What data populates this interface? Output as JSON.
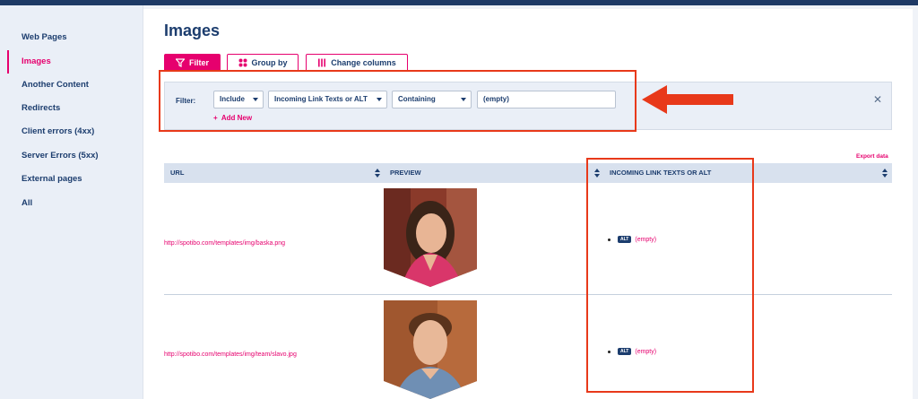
{
  "sidebar": {
    "items": [
      {
        "label": "Web Pages",
        "active": false
      },
      {
        "label": "Images",
        "active": true
      },
      {
        "label": "Another Content",
        "active": false
      },
      {
        "label": "Redirects",
        "active": false
      },
      {
        "label": "Client errors (4xx)",
        "active": false
      },
      {
        "label": "Server Errors (5xx)",
        "active": false
      },
      {
        "label": "External pages",
        "active": false
      },
      {
        "label": "All",
        "active": false
      }
    ]
  },
  "page": {
    "title": "Images"
  },
  "toolbar": {
    "filter_label": "Filter",
    "group_by_label": "Group by",
    "change_columns_label": "Change columns"
  },
  "filter": {
    "label": "Filter:",
    "mode": "Include",
    "field": "Incoming Link Texts or ALT",
    "operator": "Containing",
    "value": "(empty)",
    "add_new_label": "Add New",
    "close_icon": "close-icon"
  },
  "table": {
    "export_label": "Export data",
    "columns": [
      "URL",
      "PREVIEW",
      "INCOMING LINK TEXTS OR ALT"
    ],
    "rows": [
      {
        "url": "http://spotibo.com/templates/img/baska.png",
        "alt_badge": "ALT",
        "alt_text": "(empty)"
      },
      {
        "url": "http://spotibo.com/templates/img/team/slavo.jpg",
        "alt_badge": "ALT",
        "alt_text": "(empty)"
      }
    ]
  },
  "colors": {
    "accent": "#e6006e",
    "navy": "#1c3d6e",
    "annotation_red": "#e8391a"
  }
}
